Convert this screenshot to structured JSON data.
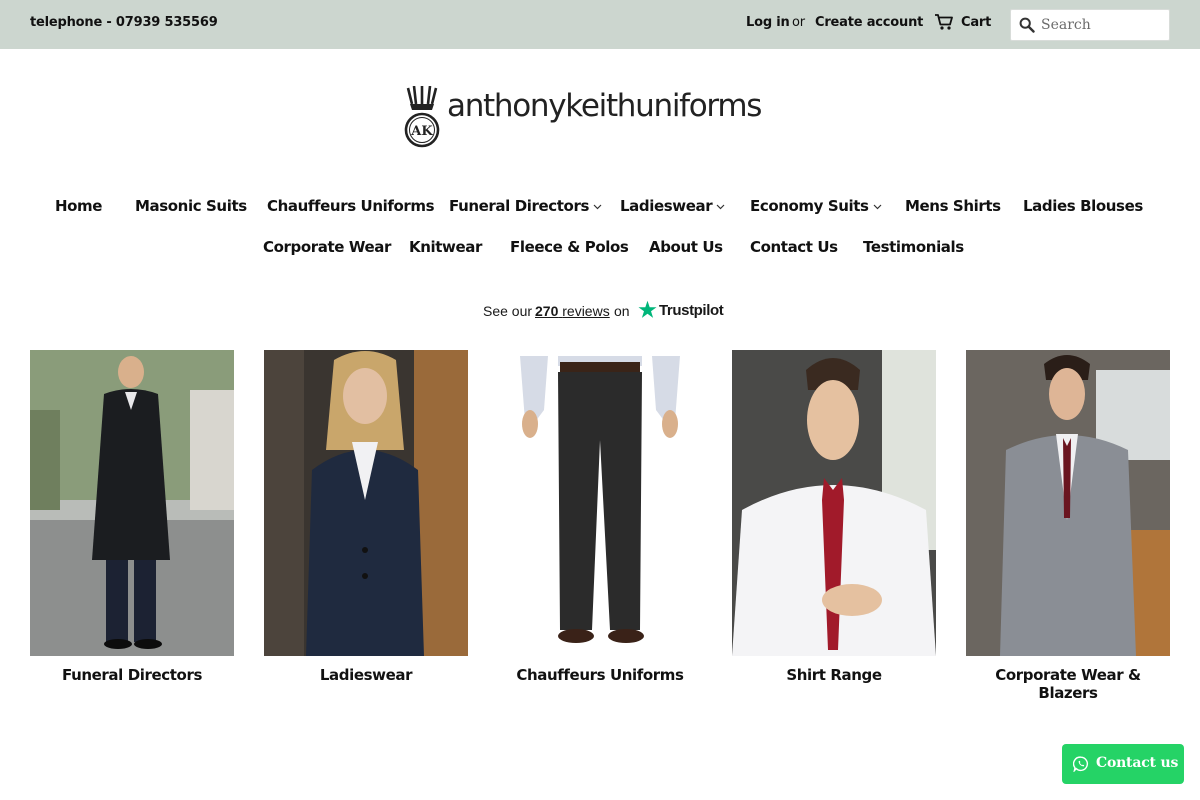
{
  "topbar": {
    "phone": "telephone - 07939 535569",
    "login": "Log in",
    "or": "or",
    "create_account": "Create account",
    "cart": "Cart",
    "cart_icon": "cart-icon",
    "search_placeholder": "Search",
    "search_icon": "search-icon"
  },
  "brand": {
    "name": "anthonykeithuniforms",
    "monogram": "AK"
  },
  "nav": {
    "row1": [
      {
        "label": "Home",
        "dropdown": false
      },
      {
        "label": "Masonic Suits",
        "dropdown": false
      },
      {
        "label": "Chauffeurs Uniforms",
        "dropdown": false
      },
      {
        "label": "Funeral Directors",
        "dropdown": true
      },
      {
        "label": "Ladieswear",
        "dropdown": true
      },
      {
        "label": "Economy Suits",
        "dropdown": true
      },
      {
        "label": "Mens Shirts",
        "dropdown": false
      },
      {
        "label": "Ladies Blouses",
        "dropdown": false
      }
    ],
    "row2": [
      {
        "label": "Corporate Wear",
        "dropdown": false
      },
      {
        "label": "Knitwear",
        "dropdown": false
      },
      {
        "label": "Fleece & Polos",
        "dropdown": false
      },
      {
        "label": "About Us",
        "dropdown": false
      },
      {
        "label": "Contact Us",
        "dropdown": false
      },
      {
        "label": "Testimonials",
        "dropdown": false
      }
    ],
    "active": "Home"
  },
  "trustpilot": {
    "prefix": "See our",
    "count": "270",
    "reviews_word": "reviews",
    "on": "on",
    "brand": "Trustpilot",
    "star_color": "#00b67a"
  },
  "collections": [
    {
      "title": "Funeral Directors"
    },
    {
      "title": "Ladieswear"
    },
    {
      "title": "Chauffeurs Uniforms"
    },
    {
      "title": "Shirt Range"
    },
    {
      "title": "Corporate Wear & Blazers"
    }
  ],
  "contact_button": {
    "label": "Contact us",
    "icon": "whatsapp-icon",
    "color": "#25d366"
  },
  "colors": {
    "topbar_bg": "#ccd6cf",
    "text": "#111111"
  }
}
